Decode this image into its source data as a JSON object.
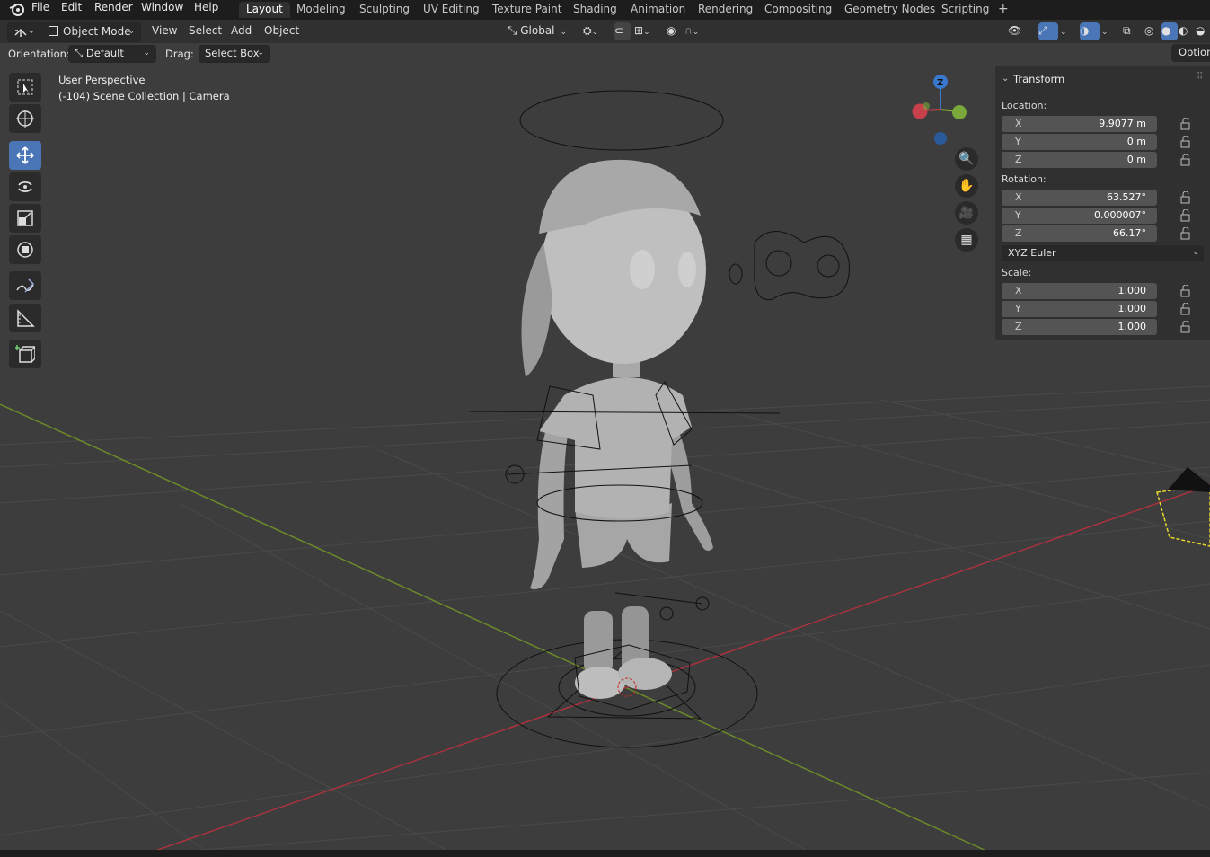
{
  "topbar": {
    "menu": [
      "File",
      "Edit",
      "Render",
      "Window",
      "Help"
    ],
    "workspaces": [
      "Layout",
      "Modeling",
      "Sculpting",
      "UV Editing",
      "Texture Paint",
      "Shading",
      "Animation",
      "Rendering",
      "Compositing",
      "Geometry Nodes",
      "Scripting"
    ],
    "active_workspace": "Layout",
    "add_tab": "+"
  },
  "header": {
    "mode": "Object Mode",
    "menus": [
      "View",
      "Select",
      "Add",
      "Object"
    ],
    "transform_orientation": "Global"
  },
  "toolsettings": {
    "orientation_label": "Orientation:",
    "orientation_value": "Default",
    "drag_label": "Drag:",
    "drag_value": "Select Box",
    "options_label": "Option"
  },
  "viewport": {
    "view_name": "User Perspective",
    "collection_info": "(-104) Scene Collection | Camera",
    "gizmo_axis": "Z"
  },
  "transform": {
    "title": "Transform",
    "location_label": "Location:",
    "location": [
      {
        "axis": "X",
        "value": "9.9077 m"
      },
      {
        "axis": "Y",
        "value": "0 m"
      },
      {
        "axis": "Z",
        "value": "0 m"
      }
    ],
    "rotation_label": "Rotation:",
    "rotation": [
      {
        "axis": "X",
        "value": "63.527°"
      },
      {
        "axis": "Y",
        "value": "0.000007°"
      },
      {
        "axis": "Z",
        "value": "66.17°"
      }
    ],
    "rotation_mode": "XYZ Euler",
    "scale_label": "Scale:",
    "scale": [
      {
        "axis": "X",
        "value": "1.000"
      },
      {
        "axis": "Y",
        "value": "1.000"
      },
      {
        "axis": "Z",
        "value": "1.000"
      }
    ]
  },
  "colors": {
    "accent": "#4a76b8",
    "x_axis": "#c8404c",
    "y_axis": "#7aa83a",
    "z_axis": "#3a78d0"
  }
}
